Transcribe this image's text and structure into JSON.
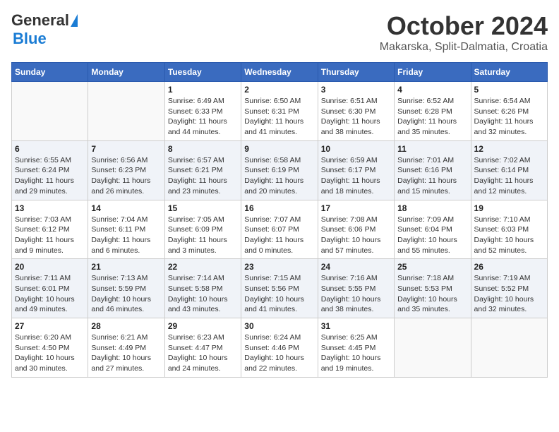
{
  "header": {
    "logo": {
      "general": "General",
      "blue": "Blue"
    },
    "title": "October 2024",
    "location": "Makarska, Split-Dalmatia, Croatia"
  },
  "weekdays": [
    "Sunday",
    "Monday",
    "Tuesday",
    "Wednesday",
    "Thursday",
    "Friday",
    "Saturday"
  ],
  "weeks": [
    [
      {
        "day": "",
        "sunrise": "",
        "sunset": "",
        "daylight": ""
      },
      {
        "day": "",
        "sunrise": "",
        "sunset": "",
        "daylight": ""
      },
      {
        "day": "1",
        "sunrise": "Sunrise: 6:49 AM",
        "sunset": "Sunset: 6:33 PM",
        "daylight": "Daylight: 11 hours and 44 minutes."
      },
      {
        "day": "2",
        "sunrise": "Sunrise: 6:50 AM",
        "sunset": "Sunset: 6:31 PM",
        "daylight": "Daylight: 11 hours and 41 minutes."
      },
      {
        "day": "3",
        "sunrise": "Sunrise: 6:51 AM",
        "sunset": "Sunset: 6:30 PM",
        "daylight": "Daylight: 11 hours and 38 minutes."
      },
      {
        "day": "4",
        "sunrise": "Sunrise: 6:52 AM",
        "sunset": "Sunset: 6:28 PM",
        "daylight": "Daylight: 11 hours and 35 minutes."
      },
      {
        "day": "5",
        "sunrise": "Sunrise: 6:54 AM",
        "sunset": "Sunset: 6:26 PM",
        "daylight": "Daylight: 11 hours and 32 minutes."
      }
    ],
    [
      {
        "day": "6",
        "sunrise": "Sunrise: 6:55 AM",
        "sunset": "Sunset: 6:24 PM",
        "daylight": "Daylight: 11 hours and 29 minutes."
      },
      {
        "day": "7",
        "sunrise": "Sunrise: 6:56 AM",
        "sunset": "Sunset: 6:23 PM",
        "daylight": "Daylight: 11 hours and 26 minutes."
      },
      {
        "day": "8",
        "sunrise": "Sunrise: 6:57 AM",
        "sunset": "Sunset: 6:21 PM",
        "daylight": "Daylight: 11 hours and 23 minutes."
      },
      {
        "day": "9",
        "sunrise": "Sunrise: 6:58 AM",
        "sunset": "Sunset: 6:19 PM",
        "daylight": "Daylight: 11 hours and 20 minutes."
      },
      {
        "day": "10",
        "sunrise": "Sunrise: 6:59 AM",
        "sunset": "Sunset: 6:17 PM",
        "daylight": "Daylight: 11 hours and 18 minutes."
      },
      {
        "day": "11",
        "sunrise": "Sunrise: 7:01 AM",
        "sunset": "Sunset: 6:16 PM",
        "daylight": "Daylight: 11 hours and 15 minutes."
      },
      {
        "day": "12",
        "sunrise": "Sunrise: 7:02 AM",
        "sunset": "Sunset: 6:14 PM",
        "daylight": "Daylight: 11 hours and 12 minutes."
      }
    ],
    [
      {
        "day": "13",
        "sunrise": "Sunrise: 7:03 AM",
        "sunset": "Sunset: 6:12 PM",
        "daylight": "Daylight: 11 hours and 9 minutes."
      },
      {
        "day": "14",
        "sunrise": "Sunrise: 7:04 AM",
        "sunset": "Sunset: 6:11 PM",
        "daylight": "Daylight: 11 hours and 6 minutes."
      },
      {
        "day": "15",
        "sunrise": "Sunrise: 7:05 AM",
        "sunset": "Sunset: 6:09 PM",
        "daylight": "Daylight: 11 hours and 3 minutes."
      },
      {
        "day": "16",
        "sunrise": "Sunrise: 7:07 AM",
        "sunset": "Sunset: 6:07 PM",
        "daylight": "Daylight: 11 hours and 0 minutes."
      },
      {
        "day": "17",
        "sunrise": "Sunrise: 7:08 AM",
        "sunset": "Sunset: 6:06 PM",
        "daylight": "Daylight: 10 hours and 57 minutes."
      },
      {
        "day": "18",
        "sunrise": "Sunrise: 7:09 AM",
        "sunset": "Sunset: 6:04 PM",
        "daylight": "Daylight: 10 hours and 55 minutes."
      },
      {
        "day": "19",
        "sunrise": "Sunrise: 7:10 AM",
        "sunset": "Sunset: 6:03 PM",
        "daylight": "Daylight: 10 hours and 52 minutes."
      }
    ],
    [
      {
        "day": "20",
        "sunrise": "Sunrise: 7:11 AM",
        "sunset": "Sunset: 6:01 PM",
        "daylight": "Daylight: 10 hours and 49 minutes."
      },
      {
        "day": "21",
        "sunrise": "Sunrise: 7:13 AM",
        "sunset": "Sunset: 5:59 PM",
        "daylight": "Daylight: 10 hours and 46 minutes."
      },
      {
        "day": "22",
        "sunrise": "Sunrise: 7:14 AM",
        "sunset": "Sunset: 5:58 PM",
        "daylight": "Daylight: 10 hours and 43 minutes."
      },
      {
        "day": "23",
        "sunrise": "Sunrise: 7:15 AM",
        "sunset": "Sunset: 5:56 PM",
        "daylight": "Daylight: 10 hours and 41 minutes."
      },
      {
        "day": "24",
        "sunrise": "Sunrise: 7:16 AM",
        "sunset": "Sunset: 5:55 PM",
        "daylight": "Daylight: 10 hours and 38 minutes."
      },
      {
        "day": "25",
        "sunrise": "Sunrise: 7:18 AM",
        "sunset": "Sunset: 5:53 PM",
        "daylight": "Daylight: 10 hours and 35 minutes."
      },
      {
        "day": "26",
        "sunrise": "Sunrise: 7:19 AM",
        "sunset": "Sunset: 5:52 PM",
        "daylight": "Daylight: 10 hours and 32 minutes."
      }
    ],
    [
      {
        "day": "27",
        "sunrise": "Sunrise: 6:20 AM",
        "sunset": "Sunset: 4:50 PM",
        "daylight": "Daylight: 10 hours and 30 minutes."
      },
      {
        "day": "28",
        "sunrise": "Sunrise: 6:21 AM",
        "sunset": "Sunset: 4:49 PM",
        "daylight": "Daylight: 10 hours and 27 minutes."
      },
      {
        "day": "29",
        "sunrise": "Sunrise: 6:23 AM",
        "sunset": "Sunset: 4:47 PM",
        "daylight": "Daylight: 10 hours and 24 minutes."
      },
      {
        "day": "30",
        "sunrise": "Sunrise: 6:24 AM",
        "sunset": "Sunset: 4:46 PM",
        "daylight": "Daylight: 10 hours and 22 minutes."
      },
      {
        "day": "31",
        "sunrise": "Sunrise: 6:25 AM",
        "sunset": "Sunset: 4:45 PM",
        "daylight": "Daylight: 10 hours and 19 minutes."
      },
      {
        "day": "",
        "sunrise": "",
        "sunset": "",
        "daylight": ""
      },
      {
        "day": "",
        "sunrise": "",
        "sunset": "",
        "daylight": ""
      }
    ]
  ]
}
